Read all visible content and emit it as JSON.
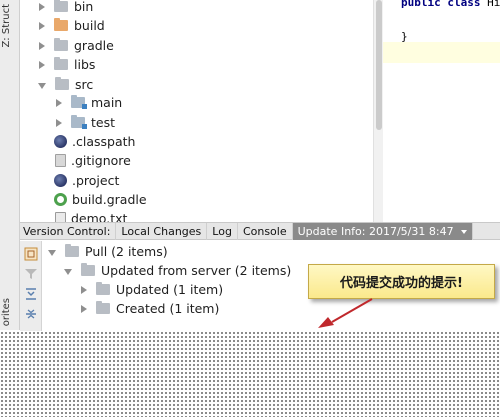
{
  "left_strip": {
    "top_label": "Z: Struct",
    "bottom_label": "orites"
  },
  "project_tree": {
    "items": [
      {
        "label": "bin",
        "icon": "folder-icon",
        "expanded": false
      },
      {
        "label": "build",
        "icon": "folder-orange-icon",
        "expanded": false
      },
      {
        "label": "gradle",
        "icon": "folder-icon",
        "expanded": false
      },
      {
        "label": "libs",
        "icon": "folder-icon",
        "expanded": false
      },
      {
        "label": "src",
        "icon": "folder-icon",
        "expanded": true
      },
      {
        "label": "main",
        "icon": "module-folder-icon",
        "expanded": false
      },
      {
        "label": "test",
        "icon": "module-folder-icon",
        "expanded": false
      },
      {
        "label": ".classpath",
        "icon": "eclipse-file-icon"
      },
      {
        "label": ".gitignore",
        "icon": "text-file-icon"
      },
      {
        "label": ".project",
        "icon": "eclipse-file-icon"
      },
      {
        "label": "build.gradle",
        "icon": "gradle-icon"
      },
      {
        "label": "demo.txt",
        "icon": "text-file-icon"
      }
    ]
  },
  "editor": {
    "line1_keywords": "public class",
    "line1_rest": " Hi",
    "line2": "}"
  },
  "bottom_tabs": {
    "version_control": "Version Control:",
    "local_changes": "Local Changes",
    "log": "Log",
    "console": "Console",
    "update_info": "Update Info: 2017/5/31 8:47"
  },
  "changes_tree": {
    "pull": "Pull (2 items)",
    "updated_from_server": "Updated from server (2 items)",
    "updated": "Updated (1 item)",
    "created": "Created (1 item)"
  },
  "callout": {
    "text": "代码提交成功的提示!"
  },
  "colors": {
    "active_tab": "#8a8a8a",
    "folder_orange": "#e9a86a",
    "callout_bg": "#fbe98c",
    "pointer_red": "#c0282c"
  }
}
